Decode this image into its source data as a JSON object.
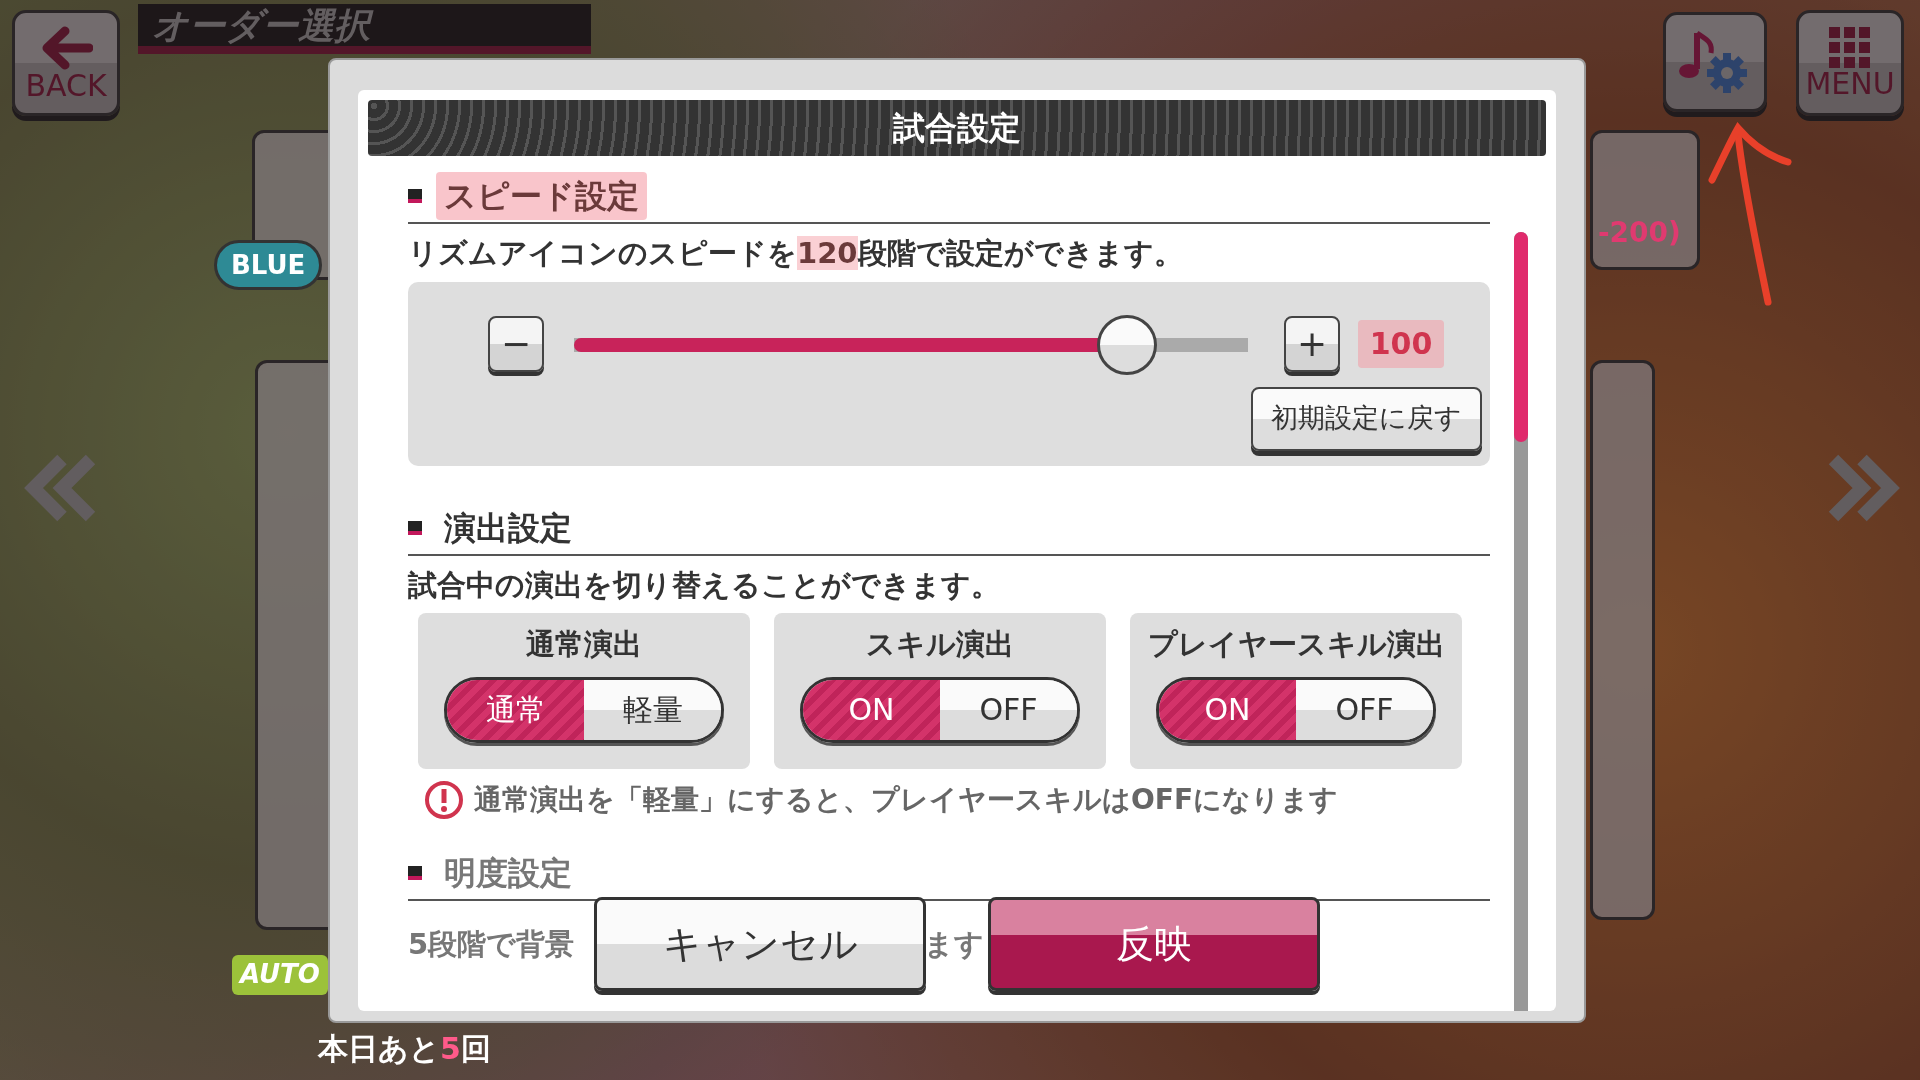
{
  "top_bar": {
    "back_button": "BACK",
    "title": "オーダー選択",
    "menu_button": "MENU"
  },
  "background": {
    "tag": "BLUE",
    "score": "-200)",
    "auto_label": "AUTO",
    "remaining": [
      {
        "text": "本日あと",
        "accent": false
      },
      {
        "text": "5",
        "accent": true
      },
      {
        "text": "回",
        "accent": false
      }
    ]
  },
  "dialog": {
    "title": "試合設定",
    "speed": {
      "heading": "スピード設定",
      "highlighted": true,
      "description": [
        {
          "text": "リズムアイコンのスピードを",
          "highlighted": false
        },
        {
          "text": "120",
          "highlighted": true
        },
        {
          "text": "段階で設定ができます。",
          "highlighted": false
        }
      ],
      "minus": "−",
      "plus": "+",
      "level": 0.82,
      "reading": "100",
      "reset_button": "初期設定に戻す"
    },
    "effects": {
      "heading": "演出設定",
      "description": "試合中の演出を切り替えることができます。",
      "toggles": [
        {
          "title": "通常演出",
          "options": [
            {
              "label": "通常",
              "selected": true
            },
            {
              "label": "軽量",
              "selected": false
            }
          ]
        },
        {
          "title": "スキル演出",
          "options": [
            {
              "label": "ON",
              "selected": true
            },
            {
              "label": "OFF",
              "selected": false
            }
          ]
        },
        {
          "title": "プレイヤースキル演出",
          "options": [
            {
              "label": "ON",
              "selected": true
            },
            {
              "label": "OFF",
              "selected": false
            }
          ]
        }
      ],
      "warning": "通常演出を「軽量」にすると、プレイヤースキルはOFFになります"
    },
    "brightness": {
      "heading": "明度設定",
      "description_start": "5段階で背景",
      "description_end": "ます"
    },
    "buttons": [
      {
        "label": "キャンセル",
        "kind": "cancel"
      },
      {
        "label": "反映",
        "kind": "apply"
      }
    ]
  }
}
